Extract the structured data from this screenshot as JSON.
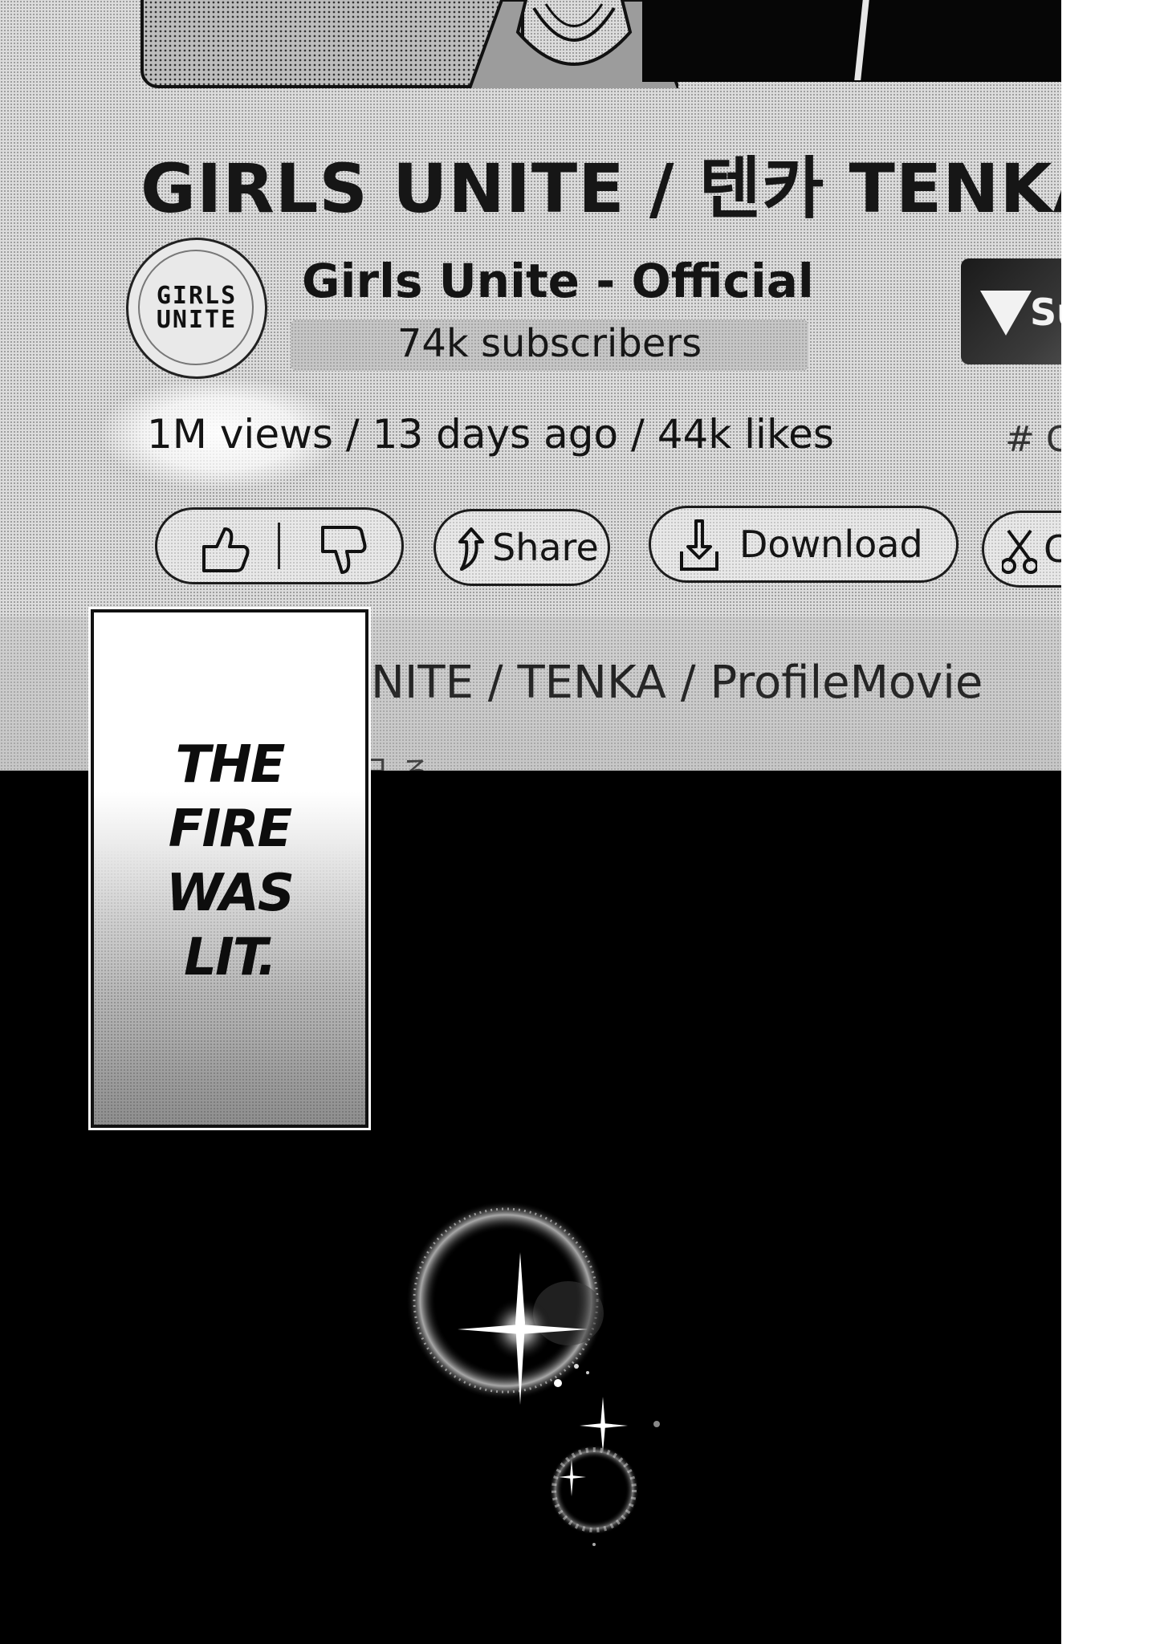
{
  "video": {
    "title": "GIRLS UNITE / 텐카 TENKA /",
    "channel": {
      "logo_text_line1": "GIRLS",
      "logo_text_line2": "UNITE",
      "name": "Girls Unite - Official",
      "subscribers": "74k subscribers",
      "subscribe_label": "Su"
    },
    "meta": "1M views / 13 days ago / 44k likes",
    "hashtag": "# C",
    "actions": {
      "share_label": "Share",
      "download_label": "Download",
      "clip_label": "C"
    },
    "description": {
      "line1": "NITE / TENKA / ProfileMovie",
      "line2": "日 ろ"
    }
  },
  "caption": {
    "lines": [
      "THE",
      "FIRE",
      "WAS",
      "LIT."
    ]
  },
  "icons": [
    "thumbs-up-icon",
    "thumbs-down-icon",
    "share-icon",
    "download-icon",
    "scissors-icon",
    "sparkle-icon"
  ],
  "colors": {
    "ink": "#141414",
    "screen": "#dcdcdc",
    "background": "#000000"
  }
}
